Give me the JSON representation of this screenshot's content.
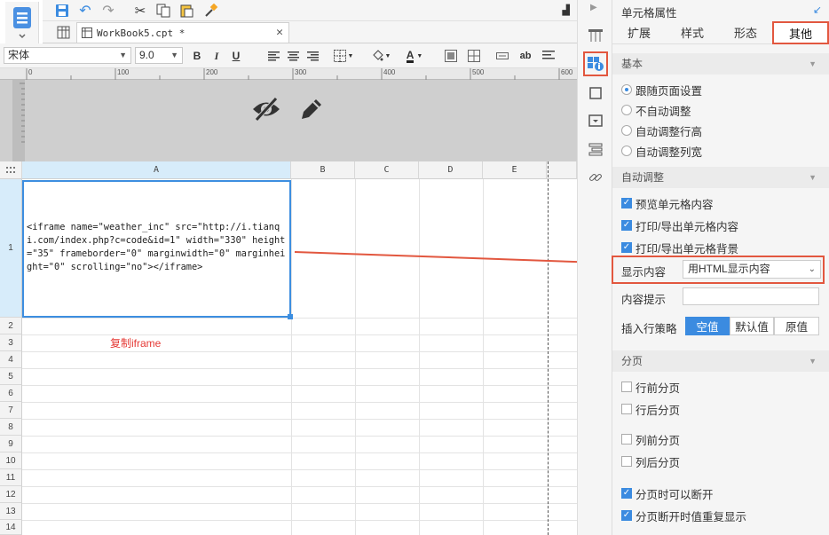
{
  "file_tab": {
    "name": "WorkBook5.cpt *"
  },
  "format": {
    "font_name": "宋体",
    "font_size": "9.0"
  },
  "ruler": {
    "ticks": [
      "0",
      "100",
      "200",
      "300",
      "400",
      "500",
      "600"
    ]
  },
  "grid": {
    "columns": [
      "A",
      "B",
      "C",
      "D",
      "E"
    ],
    "rows": [
      "1",
      "2",
      "3",
      "4",
      "5",
      "6",
      "7",
      "8",
      "9",
      "10",
      "11",
      "12",
      "13",
      "14"
    ],
    "cell_a1": "<iframe name=\"weather_inc\" src=\"http://i.tianqi.com/index.php?c=code&id=1\" width=\"330\" height=\"35\" frameborder=\"0\" marginwidth=\"0\" marginheight=\"0\" scrolling=\"no\"></iframe>",
    "annotation": "复制iframe"
  },
  "panel": {
    "title": "单元格属性",
    "tabs": [
      "扩展",
      "样式",
      "形态",
      "其他"
    ],
    "active_tab": "其他",
    "sections": {
      "basic": "基本",
      "auto_adjust": "自动调整",
      "paging": "分页"
    },
    "basic_options": [
      "跟随页面设置",
      "不自动调整",
      "自动调整行高",
      "自动调整列宽"
    ],
    "auto_checks": [
      "预览单元格内容",
      "打印/导出单元格内容",
      "打印/导出单元格背景"
    ],
    "display_label": "显示内容",
    "display_value": "用HTML显示内容",
    "hint_label": "内容提示",
    "insert_label": "插入行策略",
    "insert_options": [
      "空值",
      "默认值",
      "原值"
    ],
    "paging_checks": [
      "行前分页",
      "行后分页",
      "列前分页",
      "列后分页",
      "分页时可以断开",
      "分页断开时值重复显示"
    ]
  },
  "colors": {
    "accent": "#3b8be0",
    "highlight": "#e2573f",
    "annotation": "#e53935"
  }
}
